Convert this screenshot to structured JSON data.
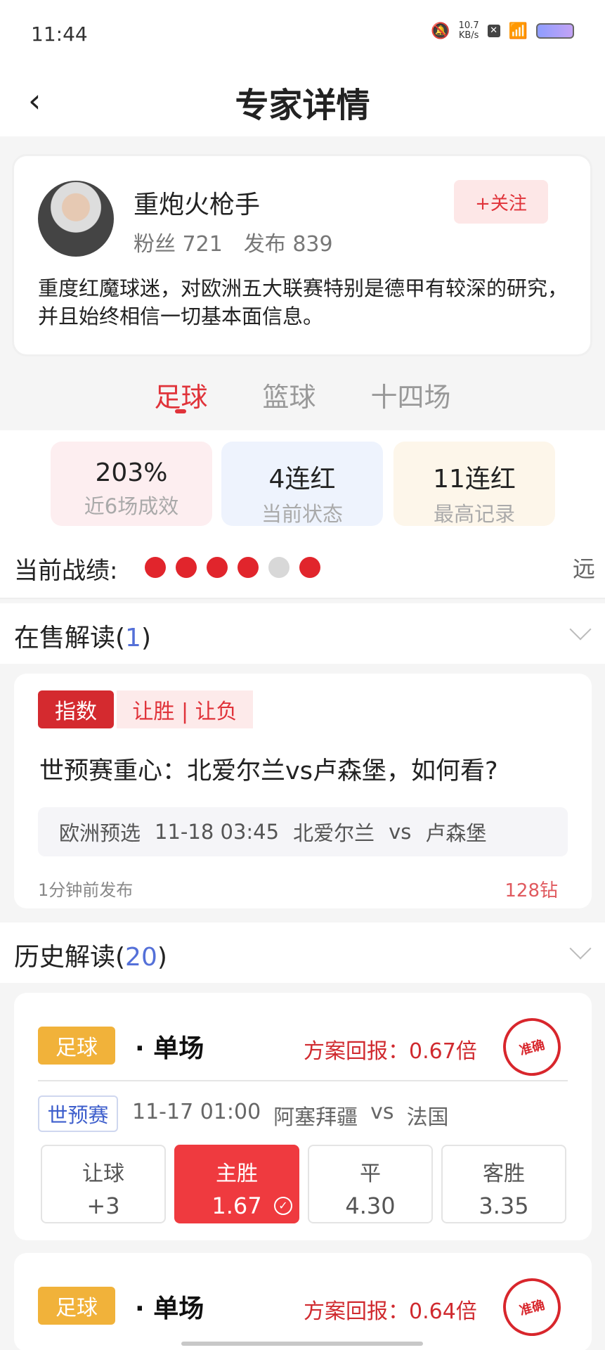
{
  "status": {
    "time": "11:44",
    "speed_value": "10.7",
    "speed_unit": "KB/s"
  },
  "header": {
    "back": "‹",
    "title": "专家详情"
  },
  "expert": {
    "name": "重炮火枪手",
    "fans": "粉丝 721",
    "posts": "发布 839",
    "follow": "+关注",
    "desc": "重度红魔球迷，对欧洲五大联赛特别是德甲有较深的研究，并且始终相信一切基本面信息。"
  },
  "tabs": [
    "足球",
    "篮球",
    "十四场"
  ],
  "stats": [
    {
      "value": "203%",
      "label": "近6场成效",
      "color": "#fdeef0"
    },
    {
      "value": "4连红",
      "label": "当前状态",
      "color": "#eef3fd"
    },
    {
      "value": "11连红",
      "label": "最高记录",
      "color": "#fdf6ea"
    }
  ],
  "record": {
    "label": "当前战绩:",
    "more": "远",
    "results": [
      "red",
      "red",
      "red",
      "red",
      "grey",
      "red"
    ]
  },
  "on_sale": {
    "title": "在售解读(",
    "count": "1",
    "close": ")",
    "card": {
      "tag1": "指数",
      "tag2": "让胜 | 让负",
      "headline": "世预赛重心：北爱尔兰vs卢森堡，如何看?",
      "league": "欧洲预选",
      "datetime": "11-18 03:45",
      "home": "北爱尔兰",
      "vs": "vs",
      "away": "卢森堡",
      "posted": "1分钟前发布",
      "price": "128钻"
    }
  },
  "history": {
    "title": "历史解读(",
    "count": "20",
    "close": ")",
    "cards": [
      {
        "sport": "足球",
        "type": "· 单场",
        "return": "方案回报：0.67倍",
        "stamp": "准确",
        "league": "世预赛",
        "datetime": "11-17 01:00",
        "home": "阿塞拜疆",
        "vs": "vs",
        "away": "法国",
        "odds": [
          {
            "label": "让球",
            "value": "+3",
            "hit": false
          },
          {
            "label": "主胜",
            "value": "1.67",
            "hit": true
          },
          {
            "label": "平",
            "value": "4.30",
            "hit": false
          },
          {
            "label": "客胜",
            "value": "3.35",
            "hit": false
          }
        ]
      },
      {
        "sport": "足球",
        "type": "· 单场",
        "return": "方案回报：0.64倍",
        "stamp": "准确"
      }
    ]
  }
}
